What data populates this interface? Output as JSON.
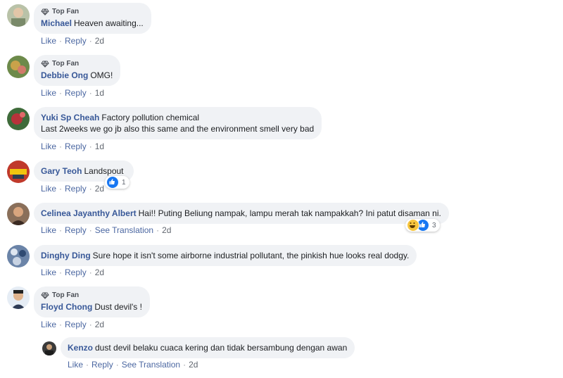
{
  "comments": [
    {
      "badge": "Top Fan",
      "author": "Michael",
      "text": "Heaven awaiting...",
      "actions": {
        "like": "Like",
        "reply": "Reply",
        "time": "2d"
      }
    },
    {
      "badge": "Top Fan",
      "author": "Debbie Ong",
      "text": "OMG!",
      "actions": {
        "like": "Like",
        "reply": "Reply",
        "time": "1d"
      }
    },
    {
      "author": "Yuki Sp Cheah",
      "text": "Factory pollution chemical",
      "text2": "Last 2weeks we go jb also this same and the environment smell very bad",
      "actions": {
        "like": "Like",
        "reply": "Reply",
        "time": "1d"
      }
    },
    {
      "author": "Gary Teoh",
      "text": "Landspout",
      "actions": {
        "like": "Like",
        "reply": "Reply",
        "time": "2d"
      },
      "reaction_count": "1"
    },
    {
      "author": "Celinea Jayanthy Albert",
      "text": "Hai!! Puting Beliung nampak, lampu merah tak nampakkah? Ini patut disaman ni.",
      "actions": {
        "like": "Like",
        "reply": "Reply",
        "translation": "See Translation",
        "time": "2d"
      },
      "reaction_count": "3"
    },
    {
      "author": "Dinghy Ding",
      "text": "Sure hope it isn't some airborne industrial pollutant, the pinkish hue looks real dodgy.",
      "actions": {
        "like": "Like",
        "reply": "Reply",
        "time": "2d"
      }
    },
    {
      "badge": "Top Fan",
      "author": "Floyd Chong",
      "text": "Dust devil's !",
      "actions": {
        "like": "Like",
        "reply": "Reply",
        "time": "2d"
      }
    }
  ],
  "reply": {
    "author": "Kenzo",
    "text": "dust devil belaku cuaca kering dan tidak bersambung dengan awan",
    "actions": {
      "like": "Like",
      "reply": "Reply",
      "translation": "See Translation",
      "time": "2d"
    }
  },
  "icons": {
    "badge": "diamond-icon",
    "like": "like-reaction-icon",
    "haha": "haha-reaction-icon"
  },
  "colors": {
    "author": "#385898",
    "link": "#4b67a1",
    "bubble": "#f0f2f5",
    "like": "#1877f2"
  }
}
